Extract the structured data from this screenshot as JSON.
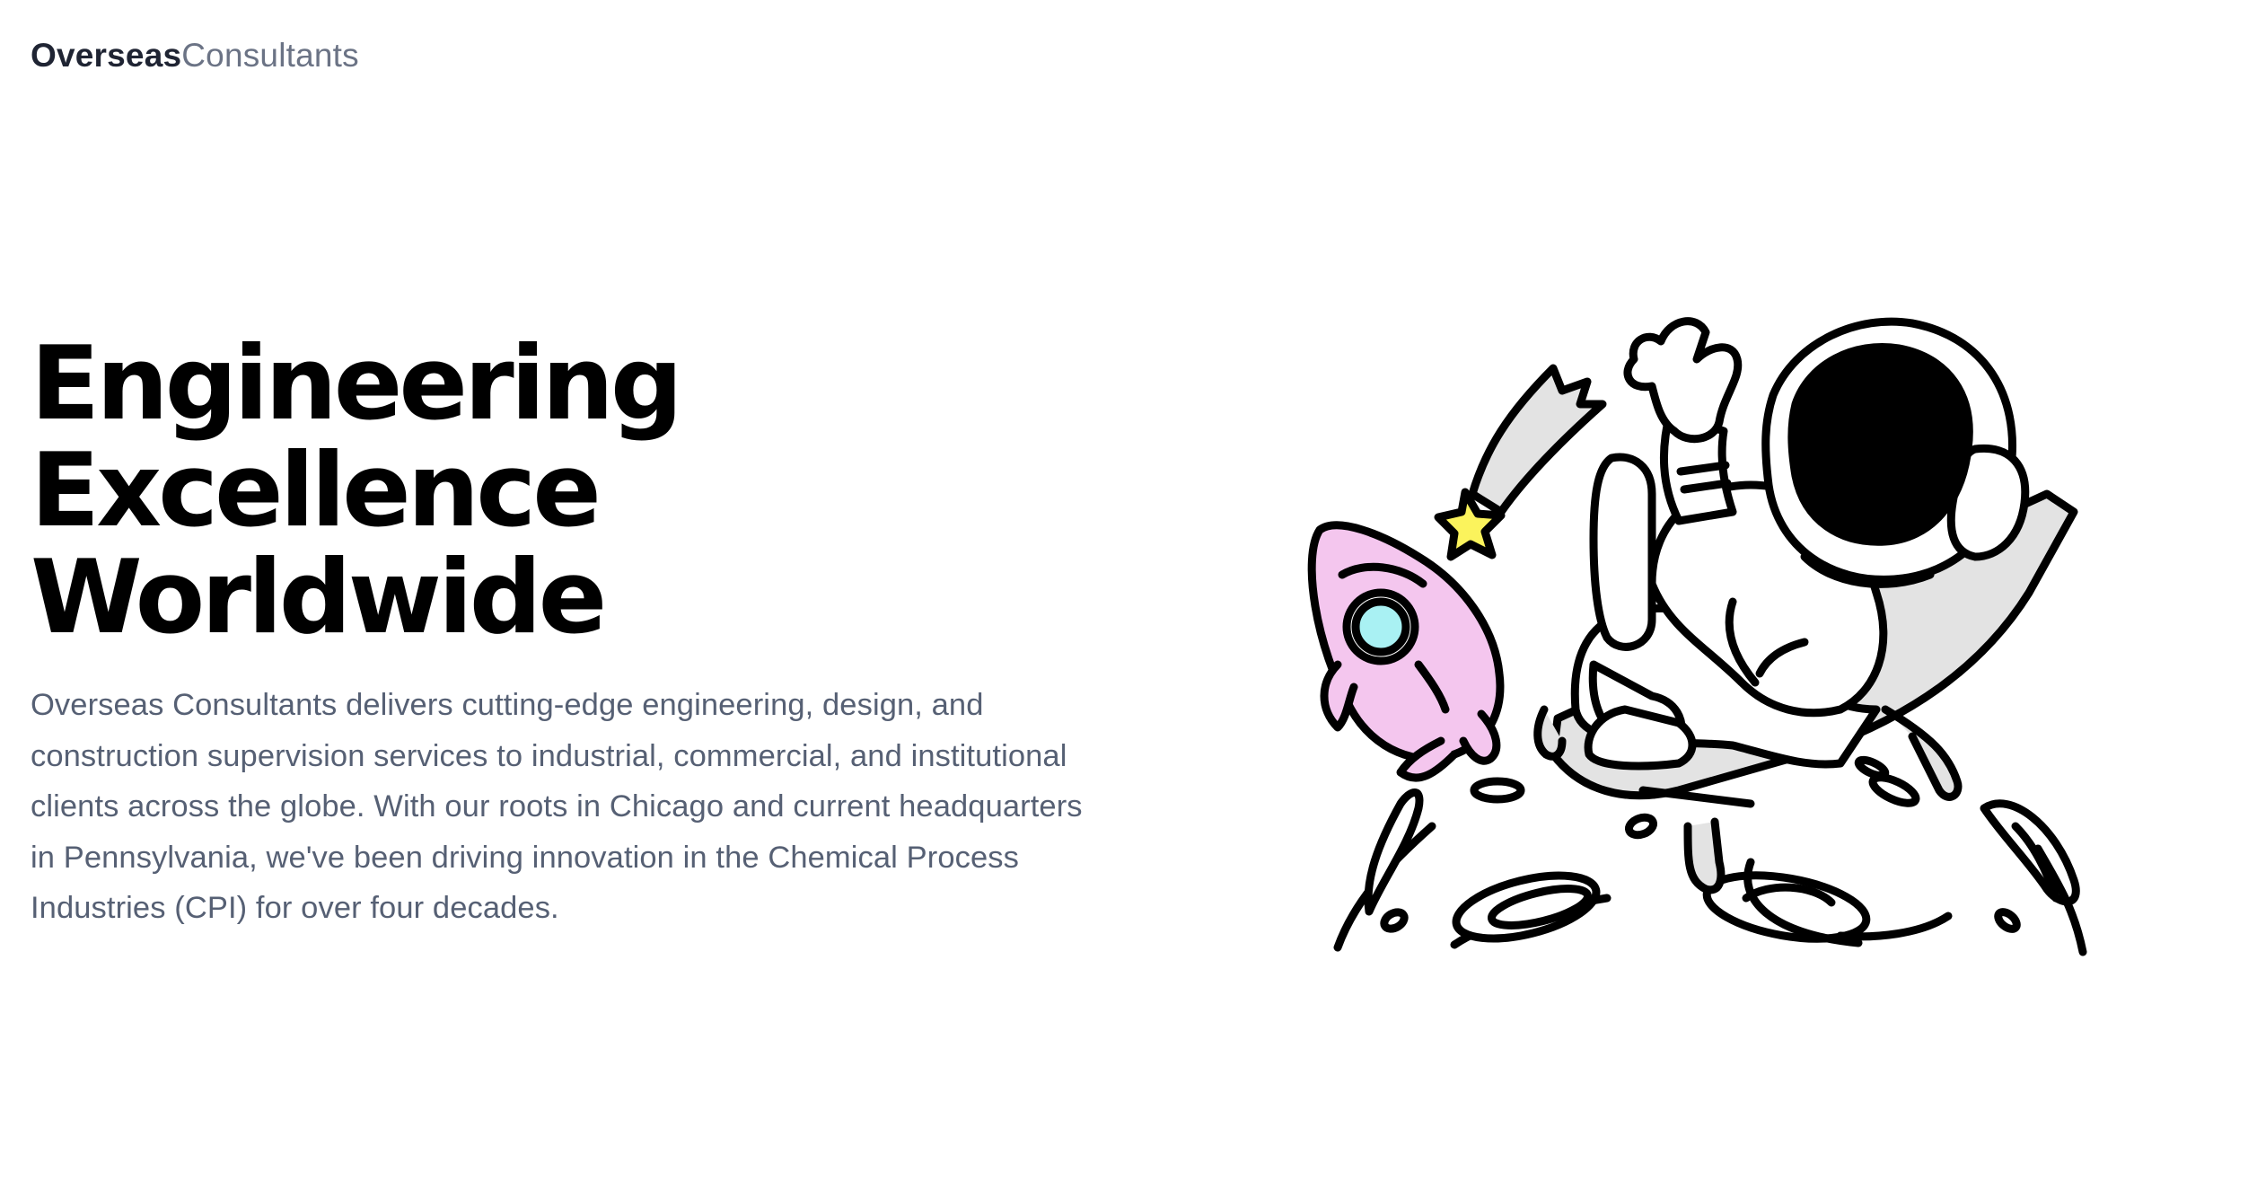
{
  "brand": {
    "strong": "Overseas",
    "light": "Consultants"
  },
  "hero": {
    "headline": [
      "Engineering",
      "Excellence",
      "Worldwide"
    ],
    "description": "Overseas Consultants delivers cutting-edge engineering, design, and construction supervision services to industrial, commercial, and institutional clients across the globe. With our roots in Chicago and current headquarters in Pennsylvania, we've been driving innovation in the Chemical Process Industries (CPI) for over four decades."
  },
  "illustration": {
    "name": "astronaut-relaxing-on-moon-illustration",
    "colors": {
      "rocket": "#f4c6ee",
      "porthole": "#a9f1f3",
      "star": "#fbf35c",
      "chair": "#e3e3e3",
      "visor": "#000000"
    }
  }
}
